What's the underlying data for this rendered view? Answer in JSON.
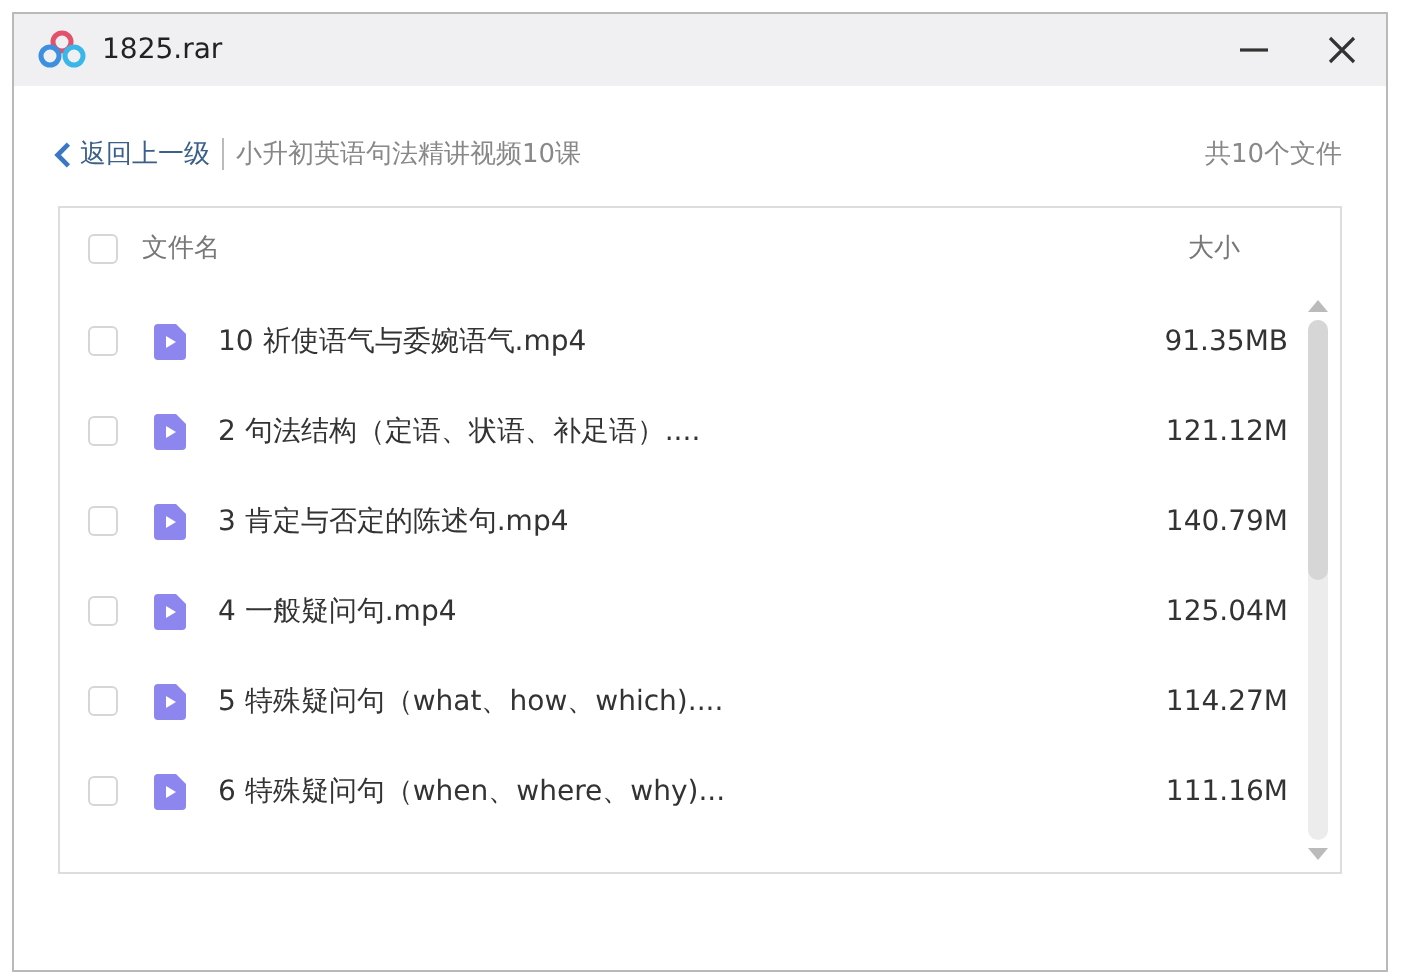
{
  "window": {
    "title": "1825.rar"
  },
  "nav": {
    "back": "返回上一级",
    "path": "小升初英语句法精讲视频10课",
    "count": "共10个文件"
  },
  "table": {
    "header": {
      "checked": false,
      "name": "文件名",
      "size": "大小"
    },
    "rows": [
      {
        "checked": false,
        "name": "10 祈使语气与委婉语气.mp4",
        "size": "91.35MB"
      },
      {
        "checked": false,
        "name": "2 句法结构（定语、状语、补足语）....",
        "size": "121.12M"
      },
      {
        "checked": false,
        "name": "3 肯定与否定的陈述句.mp4",
        "size": "140.79M"
      },
      {
        "checked": false,
        "name": "4 一般疑问句.mp4",
        "size": "125.04M"
      },
      {
        "checked": false,
        "name": "5 特殊疑问句（what、how、which)....",
        "size": "114.27M"
      },
      {
        "checked": false,
        "name": "6 特殊疑问句（when、where、why)...",
        "size": "111.16M"
      }
    ]
  }
}
